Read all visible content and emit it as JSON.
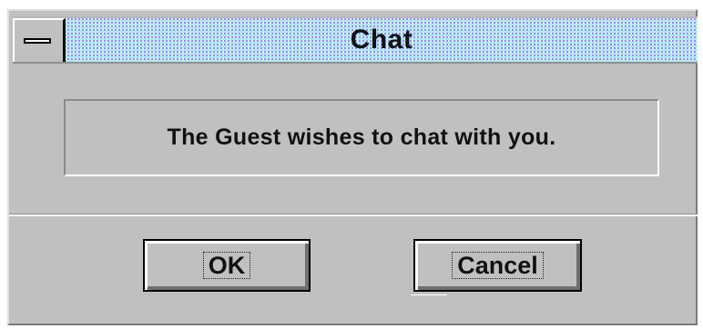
{
  "window": {
    "title": "Chat"
  },
  "message": {
    "text": "The Guest wishes to chat with you."
  },
  "buttons": {
    "ok_label": "OK",
    "cancel_label": "Cancel"
  },
  "icons": {
    "system_menu": "system-menu-icon"
  },
  "colors": {
    "dialog_bg": "#c0c0c0",
    "title_pattern": "#c4ddff",
    "text": "#111111"
  }
}
